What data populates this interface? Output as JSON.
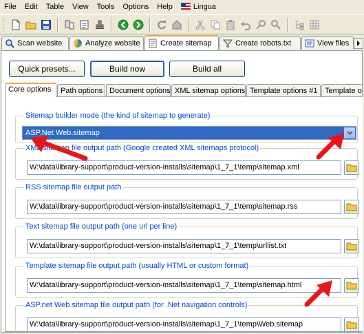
{
  "menu": {
    "items": [
      "File",
      "Edit",
      "Table",
      "View",
      "Tools",
      "Options",
      "Help"
    ],
    "lingua": "Lingua"
  },
  "toolbar": {
    "icons": [
      "new-icon",
      "open-icon",
      "save-icon",
      "toolbar-icon-4",
      "toolbar-icon-5",
      "stamp-icon",
      "back-icon",
      "forward-icon",
      "refresh-icon",
      "home-icon",
      "cut-icon",
      "copy-icon",
      "paste-icon",
      "undo-icon",
      "find-icon",
      "search-icon",
      "tree-icon",
      "grid-icon"
    ]
  },
  "main_tabs": [
    {
      "label": "Scan website",
      "icon": "scan-icon"
    },
    {
      "label": "Analyze website",
      "icon": "analyze-icon"
    },
    {
      "label": "Create sitemap",
      "icon": "create-sitemap-icon",
      "active": true
    },
    {
      "label": "Create robots.txt",
      "icon": "robots-icon"
    },
    {
      "label": "View files",
      "icon": "view-files-icon"
    }
  ],
  "buttons": {
    "quick_presets": "Quick presets...",
    "build_now": "Build now",
    "build_all": "Build all"
  },
  "sub_tabs": [
    {
      "label": "Core options",
      "active": true
    },
    {
      "label": "Path options"
    },
    {
      "label": "Document options"
    },
    {
      "label": "XML sitemap options"
    },
    {
      "label": "Template options #1"
    },
    {
      "label": "Template o"
    }
  ],
  "builder_mode": {
    "label": "Sitemap builder mode (the kind of sitemap to generate)",
    "selected": "ASP.Net Web.sitemap"
  },
  "paths": [
    {
      "label": "XML sitemap file output path (Google created XML sitemaps protocol)",
      "value": "W:\\data\\library-support\\product-version-installs\\sitemap\\1_7_1\\temp\\sitemap.xml"
    },
    {
      "label": "RSS sitemap file output path",
      "value": "W:\\data\\library-support\\product-version-installs\\sitemap\\1_7_1\\temp\\sitemap.rss"
    },
    {
      "label": "Text sitemap file output path (one url per line)",
      "value": "W:\\data\\library-support\\product-version-installs\\sitemap\\1_7_1\\temp\\urllist.txt"
    },
    {
      "label": "Template sitemap file output path (usually HTML or custom format)",
      "value": "W:\\data\\library-support\\product-version-installs\\sitemap\\1_7_1\\temp\\sitemap.html"
    },
    {
      "label": "ASP.net Web.sitemap file output path (for .Net navigation controls)",
      "value": "W:\\data\\library-support\\product-version-installs\\sitemap\\1_7_1\\temp\\Web.sitemap"
    }
  ],
  "colors": {
    "accent_arrow": "#e8161c",
    "legend_text": "#0046d5",
    "selection": "#316ac5"
  }
}
